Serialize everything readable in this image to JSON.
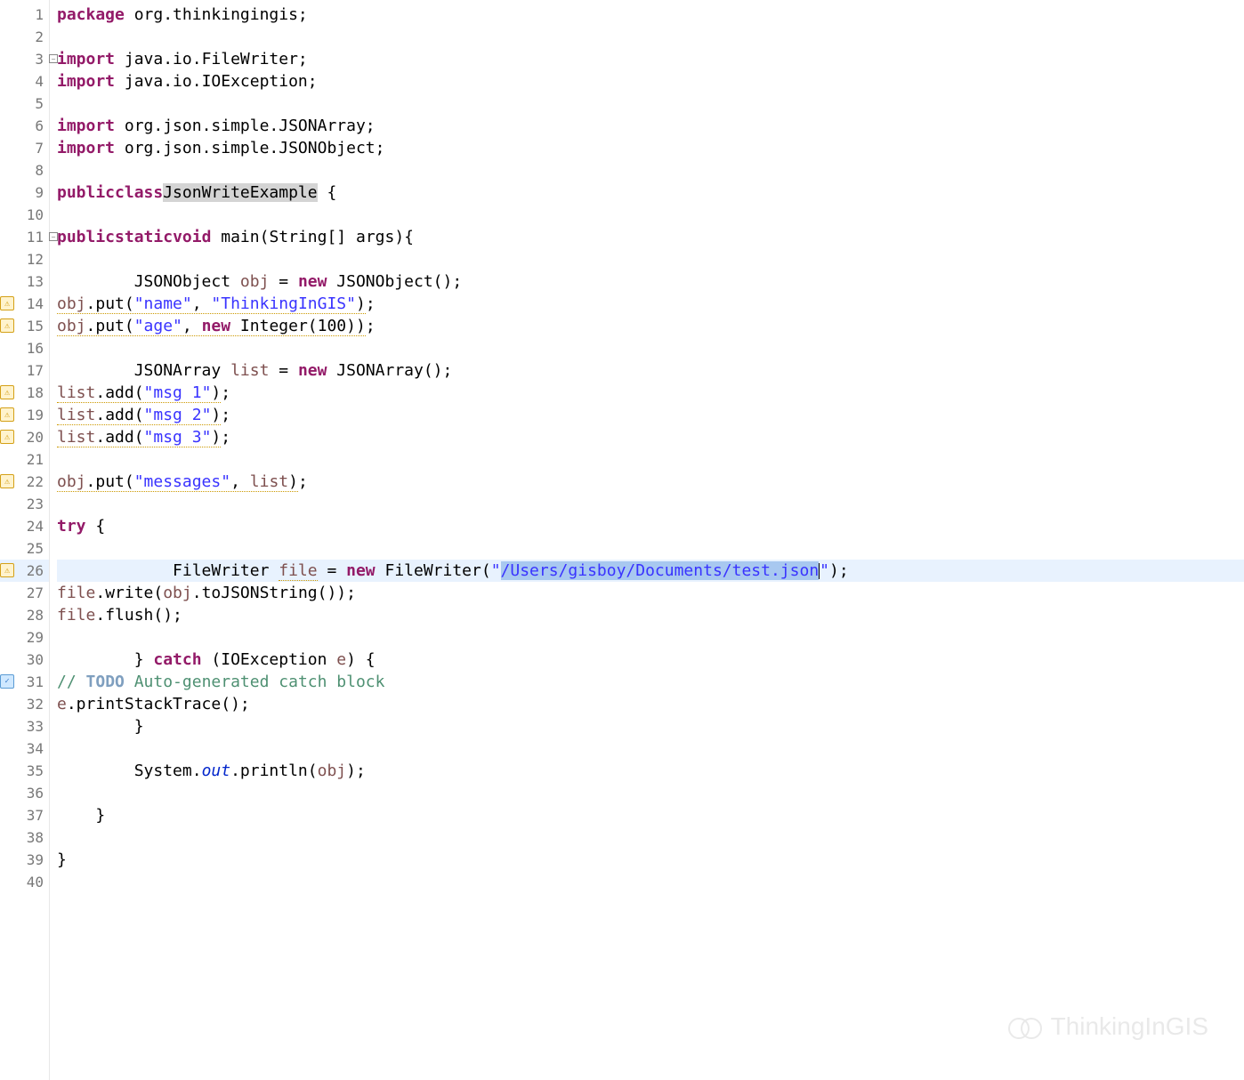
{
  "watermark": "ThinkingInGIS",
  "lines": [
    {
      "n": 1,
      "tokens": [
        [
          "kw",
          "package"
        ],
        [
          "",
          ", org.thinkingingis;"
        ]
      ],
      "raw": "package org.thinkingingis;"
    },
    {
      "n": 2,
      "raw": ""
    },
    {
      "n": 3,
      "fold": "-",
      "raw": "import java.io.FileWriter;"
    },
    {
      "n": 4,
      "raw": "import java.io.IOException;"
    },
    {
      "n": 5,
      "raw": ""
    },
    {
      "n": 6,
      "raw": "import org.json.simple.JSONArray;"
    },
    {
      "n": 7,
      "raw": "import org.json.simple.JSONObject;"
    },
    {
      "n": 8,
      "raw": ""
    },
    {
      "n": 9,
      "raw": "public class JsonWriteExample {"
    },
    {
      "n": 10,
      "raw": ""
    },
    {
      "n": 11,
      "fold": "-",
      "raw": "    public static void main(String[] args){"
    },
    {
      "n": 12,
      "raw": "        "
    },
    {
      "n": 13,
      "raw": "        JSONObject obj = new JSONObject();"
    },
    {
      "n": 14,
      "marker": "warning",
      "raw": "        obj.put(\"name\", \"ThinkingInGIS\");"
    },
    {
      "n": 15,
      "marker": "warning",
      "raw": "        obj.put(\"age\", new Integer(100));"
    },
    {
      "n": 16,
      "raw": "        "
    },
    {
      "n": 17,
      "raw": "        JSONArray list = new JSONArray();"
    },
    {
      "n": 18,
      "marker": "warning",
      "raw": "        list.add(\"msg 1\");"
    },
    {
      "n": 19,
      "marker": "warning",
      "raw": "        list.add(\"msg 2\");"
    },
    {
      "n": 20,
      "marker": "warning",
      "raw": "        list.add(\"msg 3\");"
    },
    {
      "n": 21,
      "raw": "        "
    },
    {
      "n": 22,
      "marker": "warning",
      "raw": "        obj.put(\"messages\", list);"
    },
    {
      "n": 23,
      "raw": "        "
    },
    {
      "n": 24,
      "raw": "        try {"
    },
    {
      "n": 25,
      "raw": "            "
    },
    {
      "n": 26,
      "marker": "warning",
      "current": true,
      "raw": "            FileWriter file = new FileWriter(\"/Users/gisboy/Documents/test.json\");"
    },
    {
      "n": 27,
      "raw": "            file.write(obj.toJSONString());"
    },
    {
      "n": 28,
      "raw": "            file.flush();"
    },
    {
      "n": 29,
      "raw": "            "
    },
    {
      "n": 30,
      "raw": "        } catch (IOException e) {"
    },
    {
      "n": 31,
      "marker": "task",
      "raw": "            // TODO Auto-generated catch block"
    },
    {
      "n": 32,
      "raw": "            e.printStackTrace();"
    },
    {
      "n": 33,
      "raw": "        }"
    },
    {
      "n": 34,
      "raw": "        "
    },
    {
      "n": 35,
      "raw": "        System.out.println(obj);"
    },
    {
      "n": 36,
      "raw": "        "
    },
    {
      "n": 37,
      "raw": "    }"
    },
    {
      "n": 38,
      "raw": ""
    },
    {
      "n": 39,
      "raw": "}"
    },
    {
      "n": 40,
      "raw": ""
    }
  ],
  "strings": {
    "name": "\"name\"",
    "thinkingingis": "\"ThinkingInGIS\"",
    "age": "\"age\"",
    "msg1": "\"msg 1\"",
    "msg2": "\"msg 2\"",
    "msg3": "\"msg 3\"",
    "messages": "\"messages\"",
    "filepath": "\"/Users/gisboy/Documents/test.json\"",
    "integer_val": "100"
  },
  "class_name": "JsonWriteExample",
  "selected_text": "/Users/gisboy/Documents/test.json"
}
